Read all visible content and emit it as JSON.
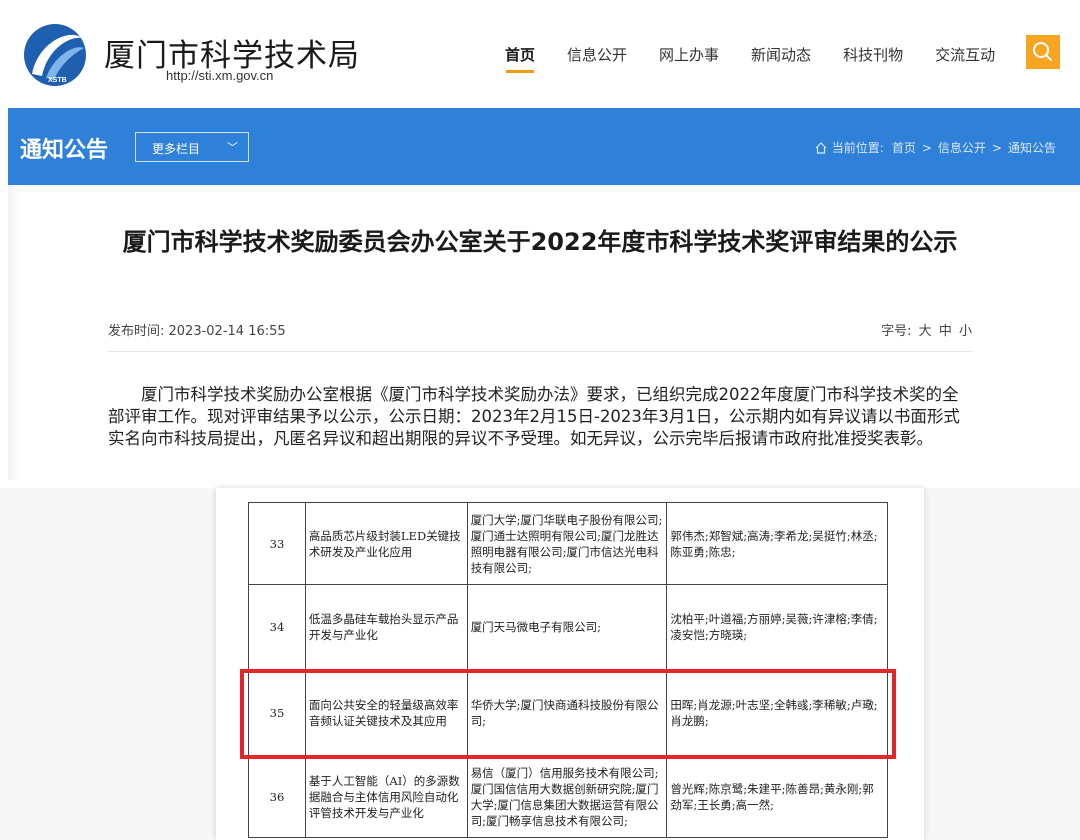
{
  "header": {
    "title": "厦门市科学技术局",
    "url": "http://sti.xm.gov.cn",
    "logo_text": "XSTB",
    "nav": [
      "首页",
      "信息公开",
      "网上办事",
      "新闻动态",
      "科技刊物",
      "交流互动"
    ],
    "search_icon": "search-icon"
  },
  "bar": {
    "title": "通知公告",
    "more_label": "更多栏目",
    "breadcrumb_prefix": "当前位置:",
    "breadcrumb": [
      "首页",
      "信息公开",
      "通知公告"
    ]
  },
  "article": {
    "title": "厦门市科学技术奖励委员会办公室关于2022年度市科学技术奖评审结果的公示",
    "date": "发布时间: 2023-02-14 16:55",
    "font_label": "字号:",
    "font_sizes": [
      "大",
      "中",
      "小"
    ],
    "body": "厦门市科学技术奖励办公室根据《厦门市科学技术奖励办法》要求，已组织完成2022年度厦门市科学技术奖的全部评审工作。现对评审结果予以公示，公示日期：2023年2月15日-2023年3月1日，公示期内如有异议请以书面形式实名向市科技局提出，凡匿名异议和超出期限的异议不予受理。如无异议，公示完毕后报请市政府批准授奖表彰。"
  },
  "table": {
    "rows": [
      {
        "no": "33",
        "project": "高品质芯片级封装LED关键技术研发及产业化应用",
        "orgs": "厦门大学;厦门华联电子股份有限公司;厦门通士达照明有限公司;厦门龙胜达照明电器有限公司;厦门市信达光电科技有限公司;",
        "people": "郭伟杰;郑智斌;高涛;李希龙;吴挺竹;林丞;陈亚勇;陈忠;"
      },
      {
        "no": "34",
        "project": "低温多晶硅车载抬头显示产品开发与产业化",
        "orgs": "厦门天马微电子有限公司;",
        "people": "沈柏平;叶道福;方丽婷;吴薇;许津榕;李倩;凌安恺;方晓瑛;"
      },
      {
        "no": "35",
        "project": "面向公共安全的轻量级高效率音频认证关键技术及其应用",
        "orgs": "华侨大学;厦门快商通科技股份有限公司;",
        "people": "田晖;肖龙源;叶志坚;全韩彧;李稀敏;卢璥;肖龙鹏;"
      },
      {
        "no": "36",
        "project": "基于人工智能（AI）的多源数据融合与主体信用风险自动化评管技术开发与产业化",
        "orgs": "易信（厦门）信用服务技术有限公司;厦门国信信用大数据创新研究院;厦门大学;厦门信息集团大数据运营有限公司;厦门畅享信息技术有限公司;",
        "people": "曾光辉;陈京鹭;朱建平;陈善昂;黄永刚;郭劲军;王长勇;高一然;"
      }
    ]
  },
  "colors": {
    "brand_blue": "#2f80d8",
    "accent_orange": "#f6a623",
    "highlight_red": "#e2262a"
  }
}
